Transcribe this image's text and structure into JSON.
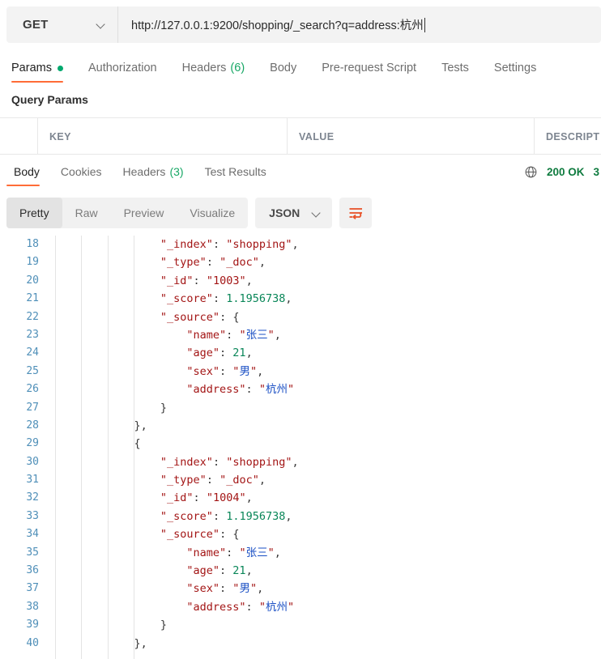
{
  "request": {
    "method": "GET",
    "method_icon": "chevron-down-icon",
    "url": "http://127.0.0.1:9200/shopping/_search?q=address:杭州",
    "tabs": [
      {
        "label": "Params",
        "active": true,
        "has_dot": true
      },
      {
        "label": "Authorization",
        "active": false,
        "has_dot": false
      },
      {
        "label": "Headers",
        "count": "(6)",
        "active": false,
        "has_dot": false
      },
      {
        "label": "Body",
        "active": false,
        "has_dot": false
      },
      {
        "label": "Pre-request Script",
        "active": false,
        "has_dot": false
      },
      {
        "label": "Tests",
        "active": false,
        "has_dot": false
      },
      {
        "label": "Settings",
        "active": false,
        "has_dot": false
      }
    ],
    "query_params_title": "Query Params",
    "table_headers": [
      "KEY",
      "VALUE",
      "DESCRIPT"
    ]
  },
  "response": {
    "tabs": [
      {
        "label": "Body",
        "active": true
      },
      {
        "label": "Cookies",
        "active": false
      },
      {
        "label": "Headers",
        "count": "(3)",
        "active": false
      },
      {
        "label": "Test Results",
        "active": false
      }
    ],
    "globe_icon": "globe-icon",
    "status": "200 OK",
    "time": "3",
    "status_color": "#0f7b3f",
    "format_tabs": [
      {
        "label": "Pretty",
        "active": true
      },
      {
        "label": "Raw",
        "active": false
      },
      {
        "label": "Preview",
        "active": false
      },
      {
        "label": "Visualize",
        "active": false
      }
    ],
    "language": "JSON",
    "language_icon": "chevron-down-icon",
    "wrap_icon": "word-wrap-icon",
    "accent_color": "#ff6c37"
  },
  "code": {
    "first_line": 18,
    "lines": [
      {
        "n": 18,
        "indent": 4,
        "tokens": [
          {
            "t": "k",
            "v": "\"_index\""
          },
          {
            "t": "p",
            "v": ": "
          },
          {
            "t": "s",
            "v": "\"shopping\""
          },
          {
            "t": "p",
            "v": ","
          }
        ]
      },
      {
        "n": 19,
        "indent": 4,
        "tokens": [
          {
            "t": "k",
            "v": "\"_type\""
          },
          {
            "t": "p",
            "v": ": "
          },
          {
            "t": "s",
            "v": "\"_doc\""
          },
          {
            "t": "p",
            "v": ","
          }
        ]
      },
      {
        "n": 20,
        "indent": 4,
        "tokens": [
          {
            "t": "k",
            "v": "\"_id\""
          },
          {
            "t": "p",
            "v": ": "
          },
          {
            "t": "s",
            "v": "\"1003\""
          },
          {
            "t": "p",
            "v": ","
          }
        ]
      },
      {
        "n": 21,
        "indent": 4,
        "tokens": [
          {
            "t": "k",
            "v": "\"_score\""
          },
          {
            "t": "p",
            "v": ": "
          },
          {
            "t": "n",
            "v": "1.1956738"
          },
          {
            "t": "p",
            "v": ","
          }
        ]
      },
      {
        "n": 22,
        "indent": 4,
        "tokens": [
          {
            "t": "k",
            "v": "\"_source\""
          },
          {
            "t": "p",
            "v": ": {"
          }
        ]
      },
      {
        "n": 23,
        "indent": 5,
        "tokens": [
          {
            "t": "k",
            "v": "\"name\""
          },
          {
            "t": "p",
            "v": ": "
          },
          {
            "t": "s",
            "v": "\""
          },
          {
            "t": "cn",
            "v": "张三"
          },
          {
            "t": "s",
            "v": "\""
          },
          {
            "t": "p",
            "v": ","
          }
        ]
      },
      {
        "n": 24,
        "indent": 5,
        "tokens": [
          {
            "t": "k",
            "v": "\"age\""
          },
          {
            "t": "p",
            "v": ": "
          },
          {
            "t": "n",
            "v": "21"
          },
          {
            "t": "p",
            "v": ","
          }
        ]
      },
      {
        "n": 25,
        "indent": 5,
        "tokens": [
          {
            "t": "k",
            "v": "\"sex\""
          },
          {
            "t": "p",
            "v": ": "
          },
          {
            "t": "s",
            "v": "\""
          },
          {
            "t": "cn",
            "v": "男"
          },
          {
            "t": "s",
            "v": "\""
          },
          {
            "t": "p",
            "v": ","
          }
        ]
      },
      {
        "n": 26,
        "indent": 5,
        "tokens": [
          {
            "t": "k",
            "v": "\"address\""
          },
          {
            "t": "p",
            "v": ": "
          },
          {
            "t": "s",
            "v": "\""
          },
          {
            "t": "cn",
            "v": "杭州"
          },
          {
            "t": "s",
            "v": "\""
          }
        ]
      },
      {
        "n": 27,
        "indent": 4,
        "tokens": [
          {
            "t": "p",
            "v": "}"
          }
        ]
      },
      {
        "n": 28,
        "indent": 3,
        "tokens": [
          {
            "t": "p",
            "v": "},"
          }
        ]
      },
      {
        "n": 29,
        "indent": 3,
        "tokens": [
          {
            "t": "p",
            "v": "{"
          }
        ]
      },
      {
        "n": 30,
        "indent": 4,
        "tokens": [
          {
            "t": "k",
            "v": "\"_index\""
          },
          {
            "t": "p",
            "v": ": "
          },
          {
            "t": "s",
            "v": "\"shopping\""
          },
          {
            "t": "p",
            "v": ","
          }
        ]
      },
      {
        "n": 31,
        "indent": 4,
        "tokens": [
          {
            "t": "k",
            "v": "\"_type\""
          },
          {
            "t": "p",
            "v": ": "
          },
          {
            "t": "s",
            "v": "\"_doc\""
          },
          {
            "t": "p",
            "v": ","
          }
        ]
      },
      {
        "n": 32,
        "indent": 4,
        "tokens": [
          {
            "t": "k",
            "v": "\"_id\""
          },
          {
            "t": "p",
            "v": ": "
          },
          {
            "t": "s",
            "v": "\"1004\""
          },
          {
            "t": "p",
            "v": ","
          }
        ]
      },
      {
        "n": 33,
        "indent": 4,
        "tokens": [
          {
            "t": "k",
            "v": "\"_score\""
          },
          {
            "t": "p",
            "v": ": "
          },
          {
            "t": "n",
            "v": "1.1956738"
          },
          {
            "t": "p",
            "v": ","
          }
        ]
      },
      {
        "n": 34,
        "indent": 4,
        "tokens": [
          {
            "t": "k",
            "v": "\"_source\""
          },
          {
            "t": "p",
            "v": ": {"
          }
        ]
      },
      {
        "n": 35,
        "indent": 5,
        "tokens": [
          {
            "t": "k",
            "v": "\"name\""
          },
          {
            "t": "p",
            "v": ": "
          },
          {
            "t": "s",
            "v": "\""
          },
          {
            "t": "cn",
            "v": "张三"
          },
          {
            "t": "s",
            "v": "\""
          },
          {
            "t": "p",
            "v": ","
          }
        ]
      },
      {
        "n": 36,
        "indent": 5,
        "tokens": [
          {
            "t": "k",
            "v": "\"age\""
          },
          {
            "t": "p",
            "v": ": "
          },
          {
            "t": "n",
            "v": "21"
          },
          {
            "t": "p",
            "v": ","
          }
        ]
      },
      {
        "n": 37,
        "indent": 5,
        "tokens": [
          {
            "t": "k",
            "v": "\"sex\""
          },
          {
            "t": "p",
            "v": ": "
          },
          {
            "t": "s",
            "v": "\""
          },
          {
            "t": "cn",
            "v": "男"
          },
          {
            "t": "s",
            "v": "\""
          },
          {
            "t": "p",
            "v": ","
          }
        ]
      },
      {
        "n": 38,
        "indent": 5,
        "tokens": [
          {
            "t": "k",
            "v": "\"address\""
          },
          {
            "t": "p",
            "v": ": "
          },
          {
            "t": "s",
            "v": "\""
          },
          {
            "t": "cn",
            "v": "杭州"
          },
          {
            "t": "s",
            "v": "\""
          }
        ]
      },
      {
        "n": 39,
        "indent": 4,
        "tokens": [
          {
            "t": "p",
            "v": "}"
          }
        ]
      },
      {
        "n": 40,
        "indent": 3,
        "tokens": [
          {
            "t": "p",
            "v": "},"
          }
        ]
      }
    ]
  }
}
